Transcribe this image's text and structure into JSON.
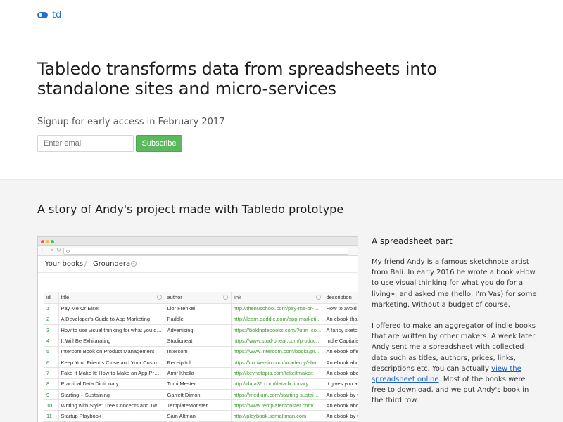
{
  "logo": {
    "icon": "toggle-icon",
    "text": "td",
    "color": "#1f6fd8"
  },
  "hero": {
    "headline": "Tabledo transforms data from spreadsheets into standalone sites and micro-services",
    "signup_text": "Signup for early access in February 2017",
    "email_placeholder": "Enter email",
    "subscribe_label": "Subscribe",
    "subscribe_color": "#5cb85c"
  },
  "story": {
    "title": "A story of Andy's project made with Tabledo prototype",
    "browser": {
      "breadcrumb": [
        "Your books",
        "Groundera"
      ],
      "separator": "/",
      "columns": [
        "id",
        "title",
        "author",
        "link",
        "description"
      ],
      "rows": [
        [
          "1",
          "Pay Me Or Else!",
          "Lior Frenkel",
          "http://thenuschool.com/pay-me-or-else",
          "How to avoid"
        ],
        [
          "2",
          "A Developer's Guide to App Marketing",
          "Paddle",
          "http://learn.paddle.com/app-marketi...",
          "An ebook that"
        ],
        [
          "3",
          "How to use visual thinking for what you do f...",
          "Advertising",
          "https://boldnotebooks.com/?utm_so...",
          "A fancy sketch"
        ],
        [
          "4",
          "It Will Be Exhilarating",
          "Studioneat",
          "https://www.stud-oneat.com/product...",
          "Indie Capitalis"
        ],
        [
          "5",
          "Intercom Book on Product Management",
          "Intercom",
          "https://www.intercom.com/books/pr...",
          "An ebook offe"
        ],
        [
          "6",
          "Keep Your Friends Close and Your Custom...",
          "Receiptful",
          "https://conversio.com/academy/ebo...",
          "An ebook abc"
        ],
        [
          "7",
          "Fake It Make It: How to Make an App Protot...",
          "Amir Khella",
          "http://keynotopia.com/fakeitmakeit",
          "An ebook abc"
        ],
        [
          "8",
          "Practical Data Dictionary",
          "Tomi Mester",
          "http://data36.com/datadictionary",
          "It gives you a"
        ],
        [
          "9",
          "Starting + Sustaining",
          "Garrett Dimon",
          "https://medium.com/starting-sustaining",
          "An ebook by t"
        ],
        [
          "10",
          "Writing with Style: Tree Concepts and Two...",
          "TemplateMonster",
          "https://www.templatemonster.com/bl...",
          "An ebook abc"
        ],
        [
          "11",
          "Startup Playbook",
          "Sam Altman",
          "http://playbook.samaltman.com",
          "An ebook by t"
        ]
      ]
    },
    "side": {
      "heading": "A spreadsheet part",
      "para1": "My friend Andy is a famous sketchnote artist from Bali. In early 2016 he wrote a book «How to use visual thinking for what you do for a living», and asked me (hello, I'm Vas) for some marketing. Without a budget of course.",
      "para2_before": "I offered to make an aggregator of indie books that are written by other makers. A week later Andy sent me a spreadsheet with collected data such as titles, authors, prices, links, descriptions etc. You can actually ",
      "para2_link": "view the spreadsheet online",
      "para2_after": ". Most of the books were free to download, and we put Andy's book in the third row."
    }
  }
}
